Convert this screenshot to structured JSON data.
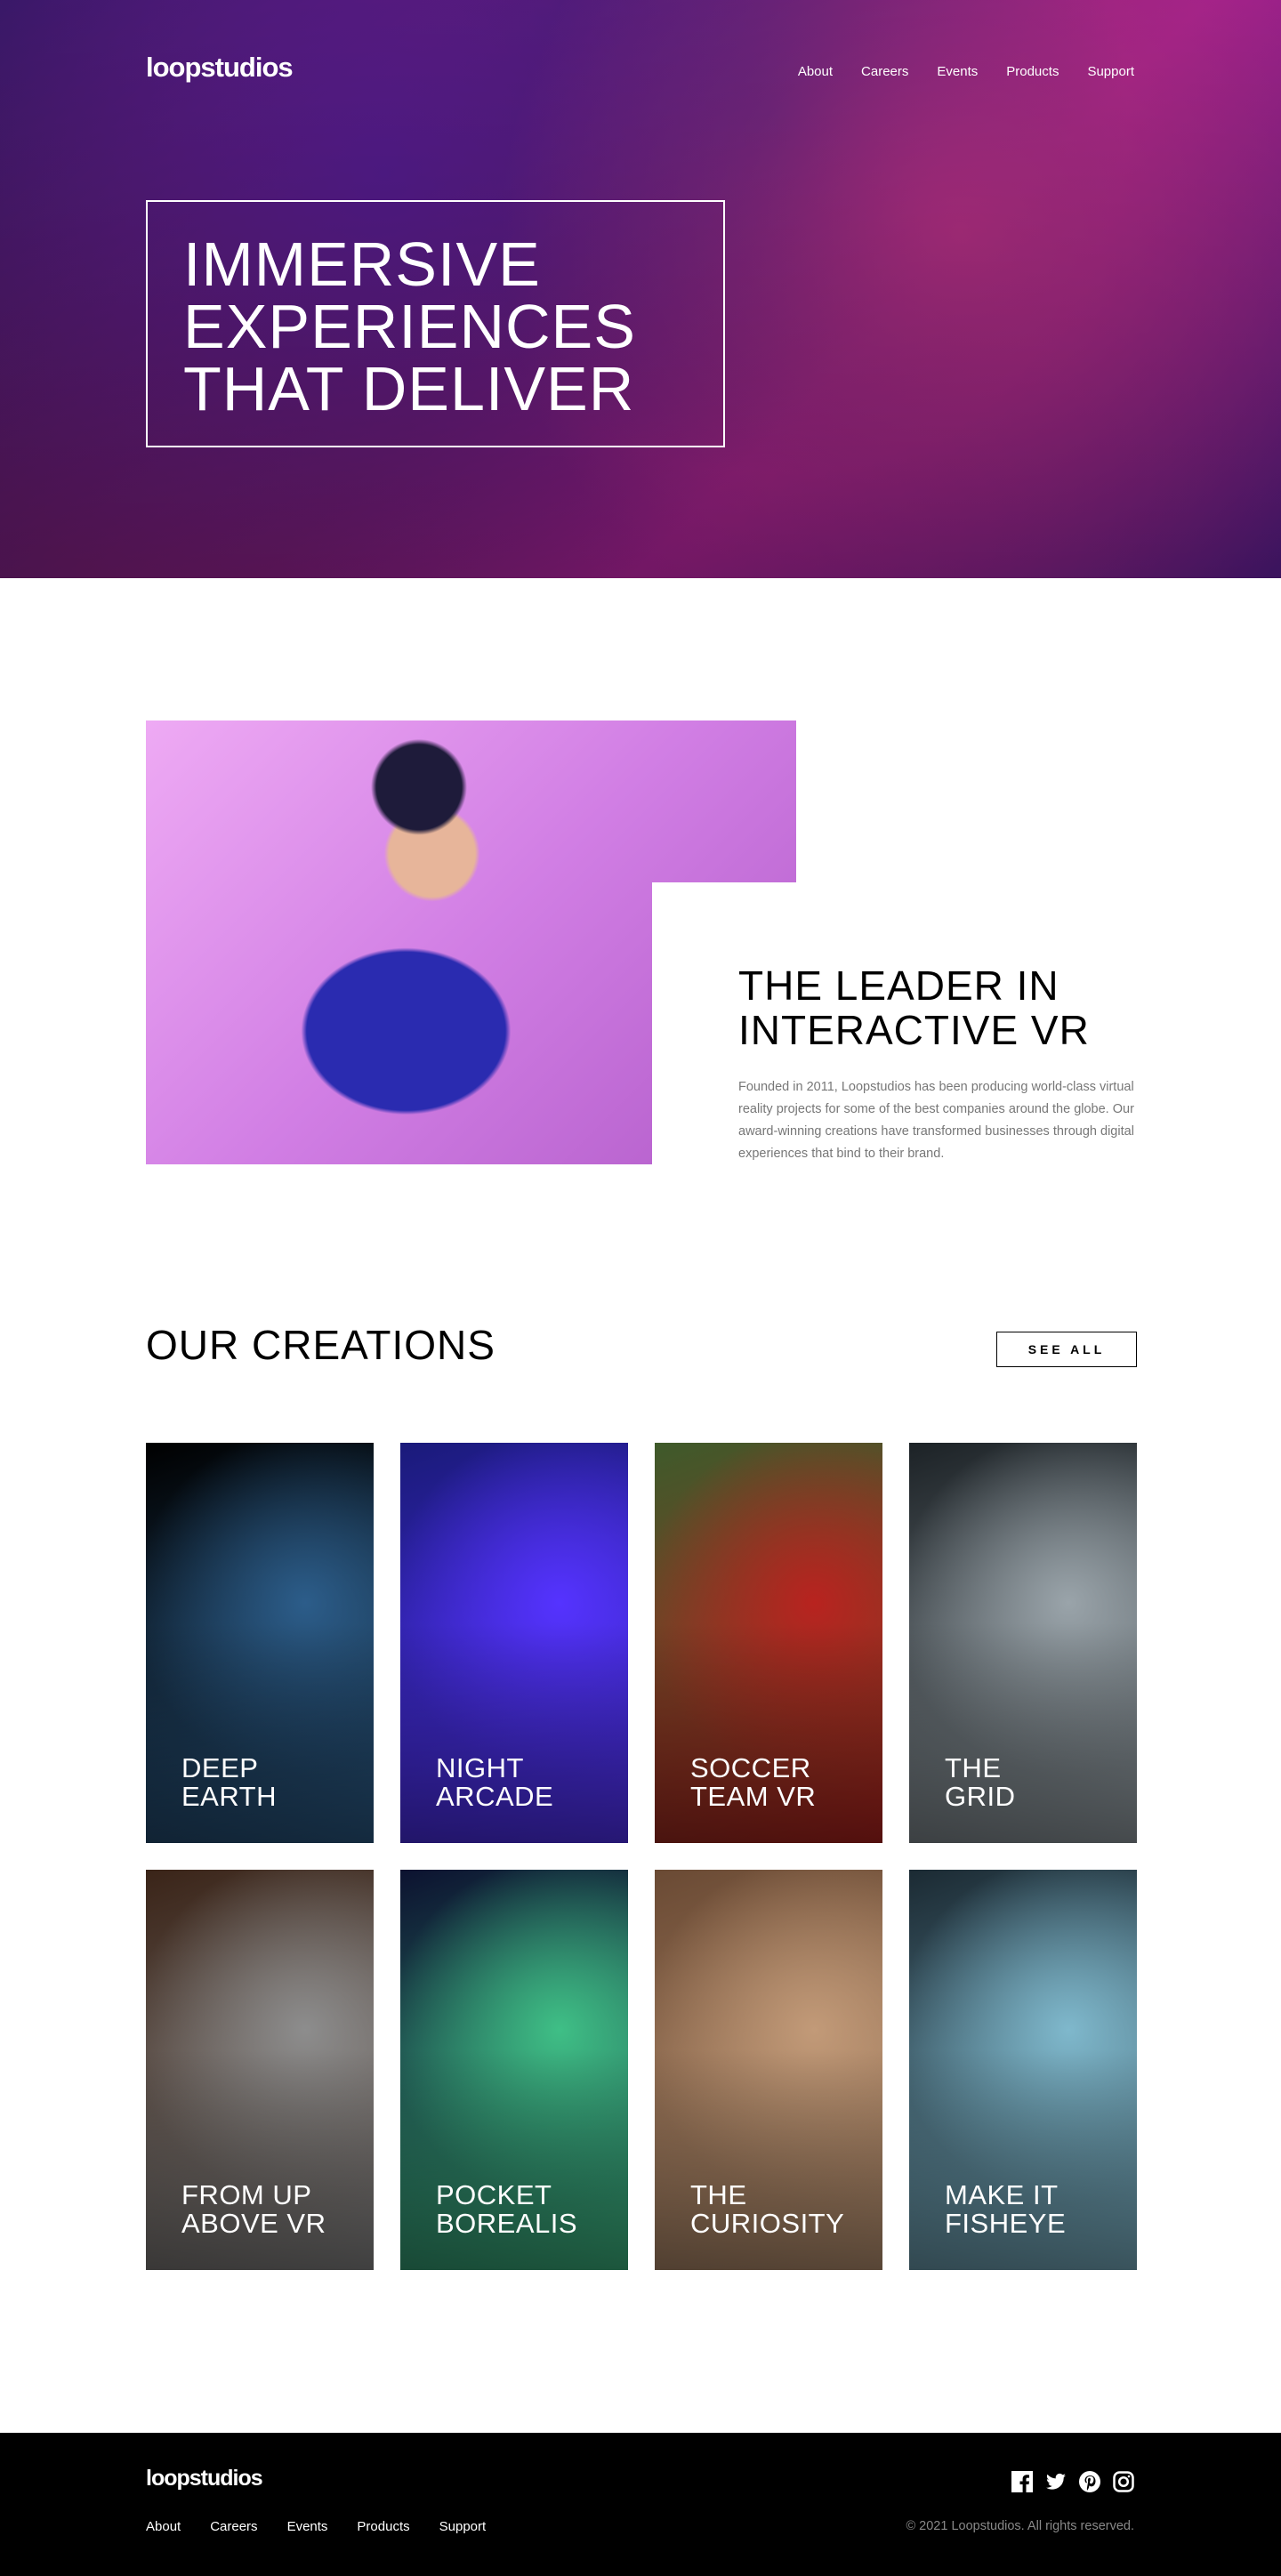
{
  "brand": "loopstudios",
  "nav": [
    "About",
    "Careers",
    "Events",
    "Products",
    "Support"
  ],
  "hero": {
    "lines": [
      "IMMERSIVE",
      "EXPERIENCES",
      "THAT DELIVER"
    ]
  },
  "about": {
    "heading_lines": [
      "THE LEADER IN",
      "INTERACTIVE VR"
    ],
    "text": "Founded in 2011, Loopstudios has been producing world-class virtual reality projects for some of the best companies around the globe. Our award-winning creations have transformed businesses through digital experiences that bind to their brand."
  },
  "creations": {
    "heading": "OUR CREATIONS",
    "see_all": "SEE ALL",
    "items": [
      {
        "title": "DEEP\nEARTH",
        "colors": [
          "#000",
          "#2c5d8a"
        ]
      },
      {
        "title": "NIGHT\nARCADE",
        "colors": [
          "#1a1a7a",
          "#5533ff"
        ]
      },
      {
        "title": "SOCCER\nTEAM VR",
        "colors": [
          "#3e5a2a",
          "#b8231f"
        ]
      },
      {
        "title": "THE\nGRID",
        "colors": [
          "#1c2226",
          "#9aa4aa"
        ]
      },
      {
        "title": "FROM UP\nABOVE VR",
        "colors": [
          "#3a2418",
          "#8d8d8d"
        ]
      },
      {
        "title": "POCKET\nBOREALIS",
        "colors": [
          "#0c1230",
          "#3fbf86"
        ]
      },
      {
        "title": "THE\nCURIOSITY",
        "colors": [
          "#6a4a34",
          "#c29a78"
        ]
      },
      {
        "title": "MAKE IT\nFISHEYE",
        "colors": [
          "#1b2a33",
          "#7fb8cc"
        ]
      }
    ]
  },
  "footer": {
    "links": [
      "About",
      "Careers",
      "Events",
      "Products",
      "Support"
    ],
    "copyright": "© 2021 Loopstudios. All rights reserved.",
    "social": [
      "facebook-icon",
      "twitter-icon",
      "pinterest-icon",
      "instagram-icon"
    ]
  }
}
